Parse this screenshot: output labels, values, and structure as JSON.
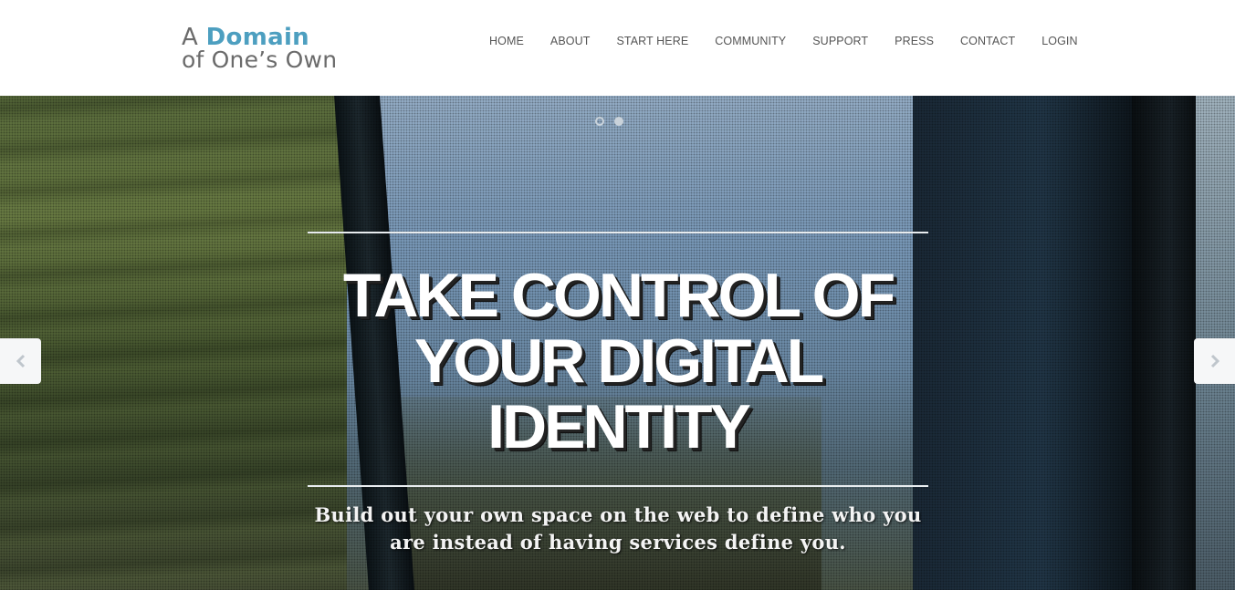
{
  "logo": {
    "line1_prefix": "A",
    "line1_accent": "Domain",
    "line2": "of One’s Own",
    "accent_color": "#4d9fc0"
  },
  "nav": {
    "items": [
      {
        "label": "HOME"
      },
      {
        "label": "ABOUT"
      },
      {
        "label": "START HERE"
      },
      {
        "label": "COMMUNITY"
      },
      {
        "label": "SUPPORT"
      },
      {
        "label": "PRESS"
      },
      {
        "label": "CONTACT"
      },
      {
        "label": "LOGIN"
      }
    ]
  },
  "hero": {
    "headline_line1": "TAKE CONTROL OF",
    "headline_line2": "YOUR DIGITAL",
    "headline_line3": "IDENTITY",
    "subline_line1": "Build out your own space on the web to define who you",
    "subline_line2": "are instead of having services define you.",
    "slides_total": 2,
    "active_slide": 2,
    "prev_icon": "chevron-left-icon",
    "next_icon": "chevron-right-icon"
  }
}
